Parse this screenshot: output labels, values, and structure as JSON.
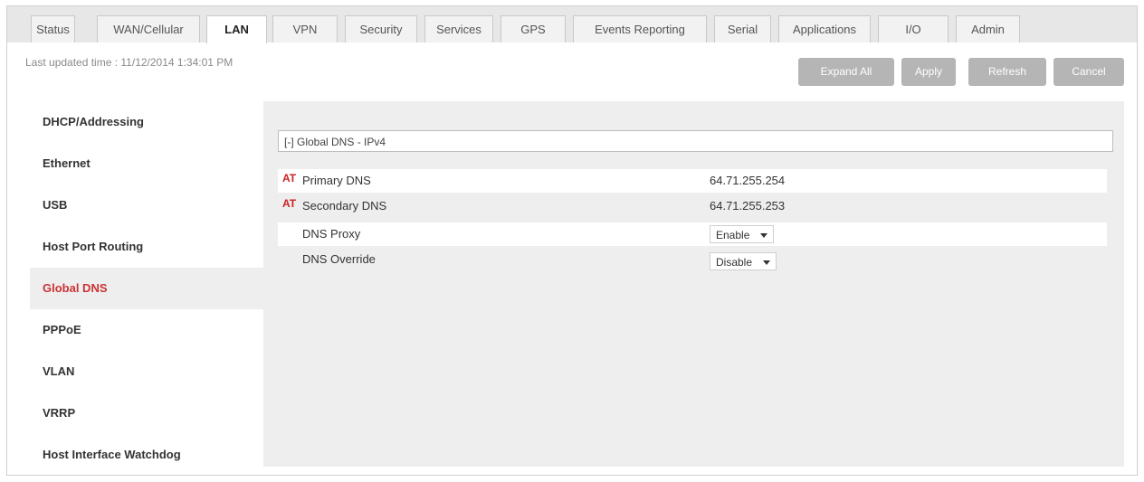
{
  "tabs": [
    {
      "label": "Status"
    },
    {
      "label": "WAN/Cellular"
    },
    {
      "label": "LAN"
    },
    {
      "label": "VPN"
    },
    {
      "label": "Security"
    },
    {
      "label": "Services"
    },
    {
      "label": "GPS"
    },
    {
      "label": "Events Reporting"
    },
    {
      "label": "Serial"
    },
    {
      "label": "Applications"
    },
    {
      "label": "I/O"
    },
    {
      "label": "Admin"
    }
  ],
  "active_tab": "LAN",
  "last_updated": "Last updated time : 11/12/2014 1:34:01 PM",
  "toolbar": {
    "expand_all": "Expand All",
    "apply": "Apply",
    "refresh": "Refresh",
    "cancel": "Cancel"
  },
  "sidebar": {
    "items": [
      {
        "label": "DHCP/Addressing"
      },
      {
        "label": "Ethernet"
      },
      {
        "label": "USB"
      },
      {
        "label": "Host Port Routing"
      },
      {
        "label": "Global DNS"
      },
      {
        "label": "PPPoE"
      },
      {
        "label": "VLAN"
      },
      {
        "label": "VRRP"
      },
      {
        "label": "Host Interface Watchdog"
      }
    ],
    "active": "Global DNS"
  },
  "section": {
    "title": "[-] Global DNS - IPv4",
    "rows": [
      {
        "marker": "AT",
        "label": "Primary DNS",
        "value": "64.71.255.254"
      },
      {
        "marker": "AT",
        "label": "Secondary DNS",
        "value": "64.71.255.253"
      },
      {
        "label": "DNS Proxy",
        "select": "Enable"
      },
      {
        "label": "DNS Override",
        "select": "Disable"
      }
    ]
  },
  "colors": {
    "accent_red": "#cc3333",
    "button_gray": "#b5b5b5",
    "panel_bg": "#eeeeee"
  }
}
